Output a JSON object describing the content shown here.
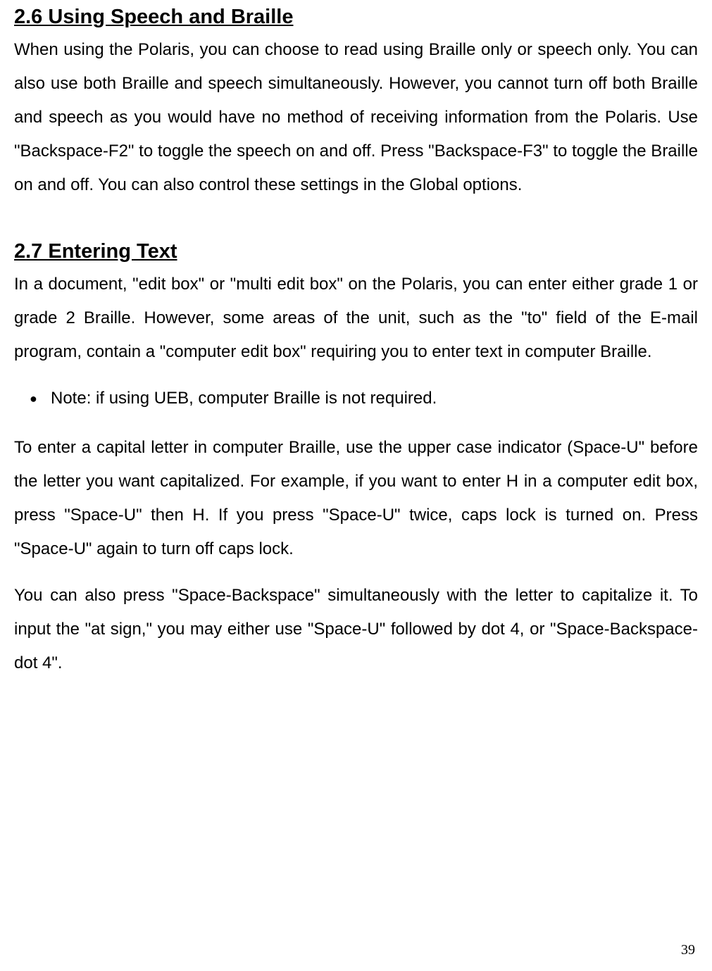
{
  "section_2_6": {
    "heading": "2.6 Using Speech and Braille",
    "para1": "When using the Polaris, you can choose to read using Braille only or speech only. You can also use both Braille and speech simultaneously. However, you cannot turn off both Braille and speech as you would have no method of receiving information from the Polaris. Use \"Backspace-F2\" to toggle the speech on and off. Press \"Backspace-F3\" to toggle the Braille on and off. You can also control these settings in the Global options."
  },
  "section_2_7": {
    "heading": "2.7 Entering Text",
    "para1": "In a document, \"edit box\" or \"multi edit box\" on the Polaris, you can enter either grade 1 or grade 2 Braille. However, some areas of the unit, such as the \"to\" field of the E-mail program, contain a \"computer edit box\" requiring you to enter text in computer Braille.",
    "bullet1": "Note: if using UEB, computer Braille is not required.",
    "para2": "To enter a capital letter in computer Braille, use the upper case indicator (Space-U\" before the letter you want capitalized. For example, if you want to enter H in a computer edit box, press \"Space-U\" then H. If you press \"Space-U\" twice, caps lock is turned on. Press \"Space-U\" again to turn off caps lock.",
    "para3": "You can also press \"Space-Backspace\" simultaneously with the letter to capitalize it. To input the \"at sign,\" you may either use \"Space-U\" followed by dot 4, or \"Space-Backspace-dot 4\"."
  },
  "page_number": "39"
}
